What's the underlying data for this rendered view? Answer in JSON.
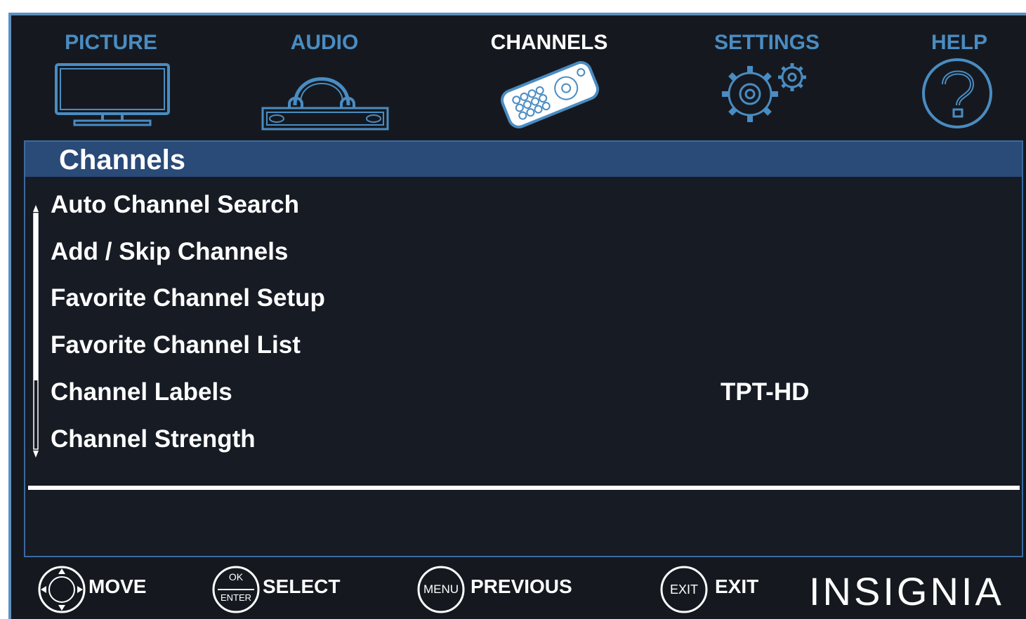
{
  "tabs": [
    {
      "label": "PICTURE",
      "icon": "tv-icon"
    },
    {
      "label": "AUDIO",
      "icon": "headphones-icon"
    },
    {
      "label": "CHANNELS",
      "icon": "remote-icon",
      "active": true
    },
    {
      "label": "SETTINGS",
      "icon": "gears-icon"
    },
    {
      "label": "HELP",
      "icon": "question-icon"
    }
  ],
  "panel": {
    "title": "Channels",
    "items": [
      {
        "label": "Auto Channel Search",
        "value": ""
      },
      {
        "label": "Add / Skip Channels",
        "value": ""
      },
      {
        "label": "Favorite Channel Setup",
        "value": ""
      },
      {
        "label": "Favorite Channel List",
        "value": ""
      },
      {
        "label": "Channel Labels",
        "value": "TPT-HD"
      },
      {
        "label": "Channel Strength",
        "value": ""
      }
    ]
  },
  "footer": {
    "move": {
      "label": "MOVE",
      "icon": "dpad-icon"
    },
    "select": {
      "label": "SELECT",
      "icon": "ok-enter-icon",
      "icon_top": "OK",
      "icon_bottom": "ENTER"
    },
    "previous": {
      "label": "PREVIOUS",
      "icon": "menu-icon",
      "icon_text": "MENU"
    },
    "exit": {
      "label": "EXIT",
      "icon": "exit-icon",
      "icon_text": "EXIT"
    },
    "brand": "INSIGNIA"
  },
  "colors": {
    "accent": "#4a8cc2",
    "background": "#15191f",
    "header": "#2a4a78"
  }
}
